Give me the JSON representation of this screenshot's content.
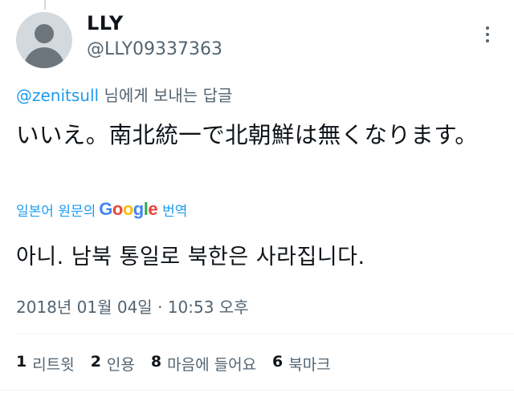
{
  "author": {
    "display_name": "LLY",
    "handle": "@LLY09337363"
  },
  "reply": {
    "mention": "@zenitsull",
    "suffix": "님에게 보내는 답글"
  },
  "tweet": {
    "text": "いいえ。南北統一で北朝鮮は無くなります。"
  },
  "translation": {
    "prefix": "일본어 원문의",
    "google_letters": [
      {
        "ch": "G",
        "color": "#4285F4"
      },
      {
        "ch": "o",
        "color": "#EA4335"
      },
      {
        "ch": "o",
        "color": "#FBBC05"
      },
      {
        "ch": "g",
        "color": "#4285F4"
      },
      {
        "ch": "l",
        "color": "#34A853"
      },
      {
        "ch": "e",
        "color": "#EA4335"
      }
    ],
    "suffix": "번역",
    "text": "아니. 남북 통일로 북한은 사라집니다."
  },
  "timestamp": "2018년 01월 04일 · 10:53 오후",
  "stats": {
    "retweets": {
      "count": "1",
      "label": "리트윗"
    },
    "quotes": {
      "count": "2",
      "label": "인용"
    },
    "likes": {
      "count": "8",
      "label": "마음에 들어요"
    },
    "bookmarks": {
      "count": "6",
      "label": "북마크"
    }
  },
  "colors": {
    "link": "#1d9bf0",
    "secondary": "#536471",
    "text": "#0f1419"
  },
  "icons": {
    "avatar": "default-avatar-icon",
    "more": "more-vertical-icon"
  }
}
